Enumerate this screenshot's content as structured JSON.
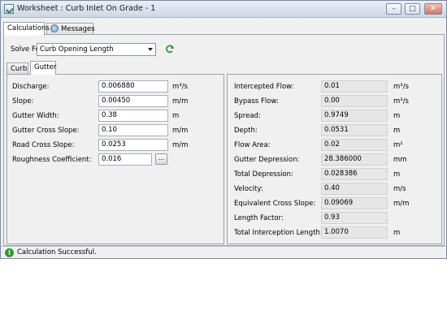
{
  "window": {
    "title": "Worksheet : Curb Inlet On Grade - 1"
  },
  "tabs": [
    {
      "label": "Calculations"
    },
    {
      "label": "Messages"
    }
  ],
  "solve_for": {
    "label": "Solve For:",
    "value": "Curb Opening Length"
  },
  "subtabs": [
    {
      "label": "Curb"
    },
    {
      "label": "Gutter"
    }
  ],
  "inputs": [
    {
      "label": "Discharge:",
      "value": "0.006880",
      "unit": "m³/s"
    },
    {
      "label": "Slope:",
      "value": "0.00450",
      "unit": "m/m"
    },
    {
      "label": "Gutter Width:",
      "value": "0.38",
      "unit": "m"
    },
    {
      "label": "Gutter Cross Slope:",
      "value": "0.10",
      "unit": "m/m"
    },
    {
      "label": "Road Cross Slope:",
      "value": "0.0253",
      "unit": "m/m"
    },
    {
      "label": "Roughness Coefficient:",
      "value": "0.016",
      "button": "..."
    }
  ],
  "results": [
    {
      "label": "Intercepted Flow:",
      "value": "0.01",
      "unit": "m³/s"
    },
    {
      "label": "Bypass Flow:",
      "value": "0.00",
      "unit": "m³/s"
    },
    {
      "label": "Spread:",
      "value": "0.9749",
      "unit": "m"
    },
    {
      "label": "Depth:",
      "value": "0.0531",
      "unit": "m"
    },
    {
      "label": "Flow Area:",
      "value": "0.02",
      "unit": "m²"
    },
    {
      "label": "Gutter Depression:",
      "value": "28.386000",
      "unit": "mm"
    },
    {
      "label": "Total Depression:",
      "value": "0.028386",
      "unit": "m"
    },
    {
      "label": "Velocity:",
      "value": "0.40",
      "unit": "m/s"
    },
    {
      "label": "Equivalent Cross Slope:",
      "value": "0.09069",
      "unit": "m/m"
    },
    {
      "label": "Length Factor:",
      "value": "0.93",
      "unit": ""
    },
    {
      "label": "Total Interception Length:",
      "value": "1.0070",
      "unit": "m"
    }
  ],
  "status": {
    "text": "Calculation Successful.",
    "icon": "info-icon"
  },
  "colors": {
    "status_ok": "#2f9a2f",
    "readonly_bg": "#e6e6e6"
  }
}
